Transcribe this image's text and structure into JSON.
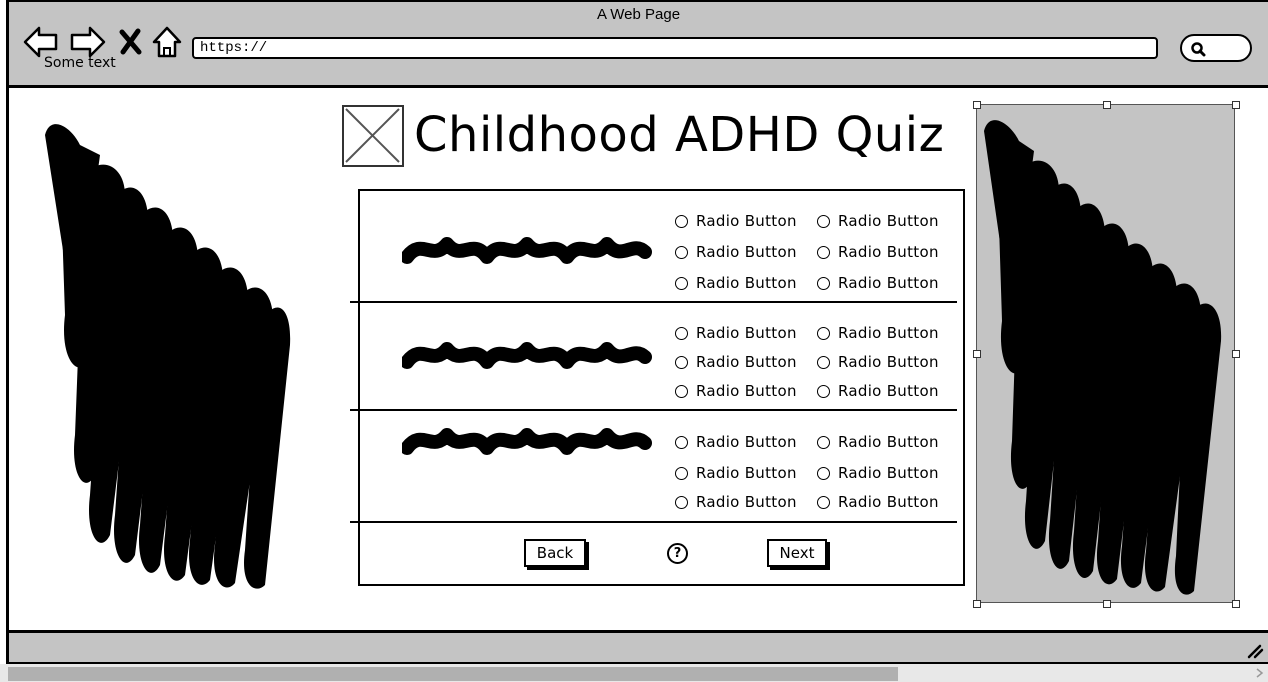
{
  "window": {
    "title": "A Web Page",
    "url": "https://",
    "nav_caption": "Some text"
  },
  "page": {
    "title": "Childhood ADHD Quiz"
  },
  "quiz": {
    "questions": [
      {
        "options": [
          "Radio Button",
          "Radio Button",
          "Radio Button",
          "Radio Button",
          "Radio Button",
          "Radio Button"
        ]
      },
      {
        "options": [
          "Radio Button",
          "Radio Button",
          "Radio Button",
          "Radio Button",
          "Radio Button",
          "Radio Button"
        ]
      },
      {
        "options": [
          "Radio Button",
          "Radio Button",
          "Radio Button",
          "Radio Button",
          "Radio Button",
          "Radio Button"
        ]
      }
    ],
    "back_label": "Back",
    "next_label": "Next",
    "help_glyph": "?"
  },
  "icons": {
    "back": "back-arrow-icon",
    "forward": "forward-arrow-icon",
    "stop": "close-icon",
    "home": "home-icon",
    "search": "search-icon",
    "help": "help-icon",
    "image": "image-placeholder-icon"
  },
  "colors": {
    "chrome": "#c4c4c4",
    "selected_panel": "#c4c4c4",
    "ink": "#000000"
  }
}
